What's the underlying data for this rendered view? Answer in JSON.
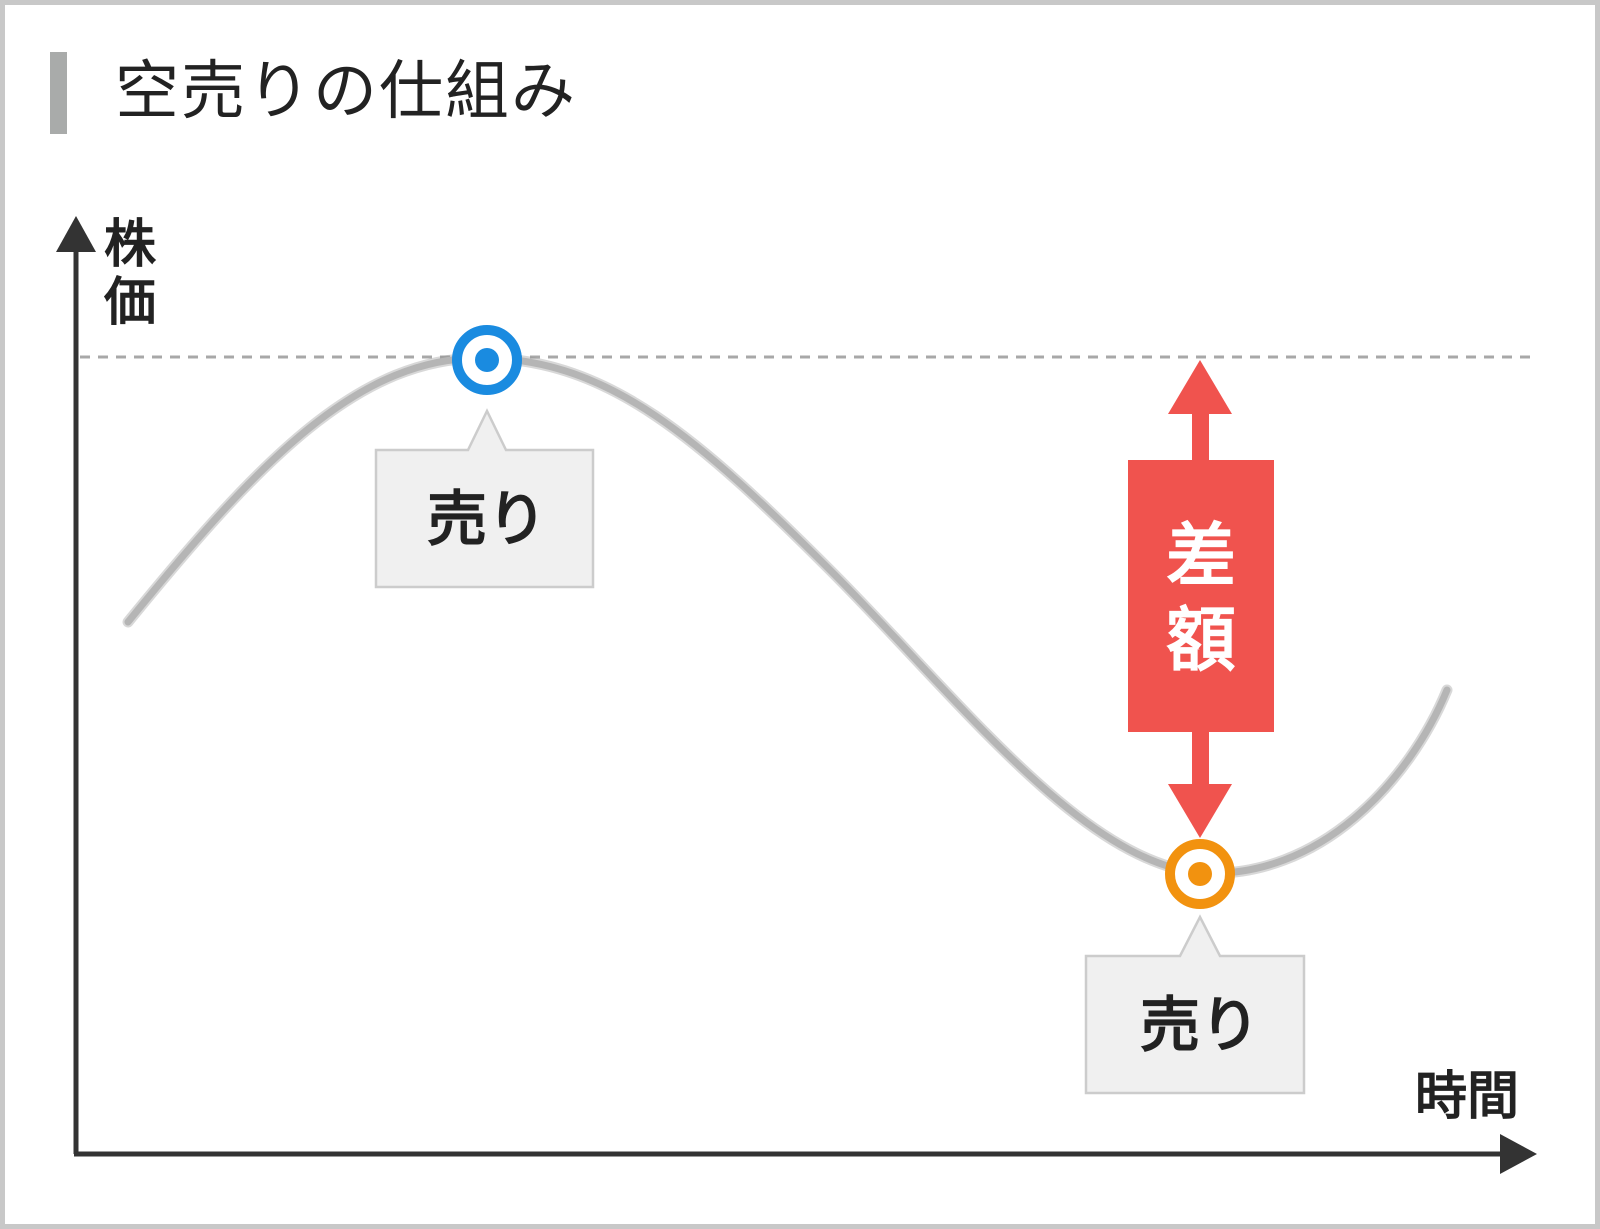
{
  "title": "空売りの仕組み",
  "axes": {
    "y_label_line1": "株",
    "y_label_line2": "価",
    "x_label": "時間"
  },
  "sell_point_1": {
    "label": "売り",
    "color": "#1a8be0"
  },
  "sell_point_2": {
    "label": "売り",
    "color": "#f2920f"
  },
  "difference": {
    "label_line1": "差",
    "label_line2": "額",
    "color": "#f0534e"
  },
  "colors": {
    "axis": "#333333",
    "curve": "#b5b5b5",
    "dashed_line": "#a8a8a8",
    "callout_fill": "#f0f0f0",
    "callout_border": "#cccccc"
  }
}
